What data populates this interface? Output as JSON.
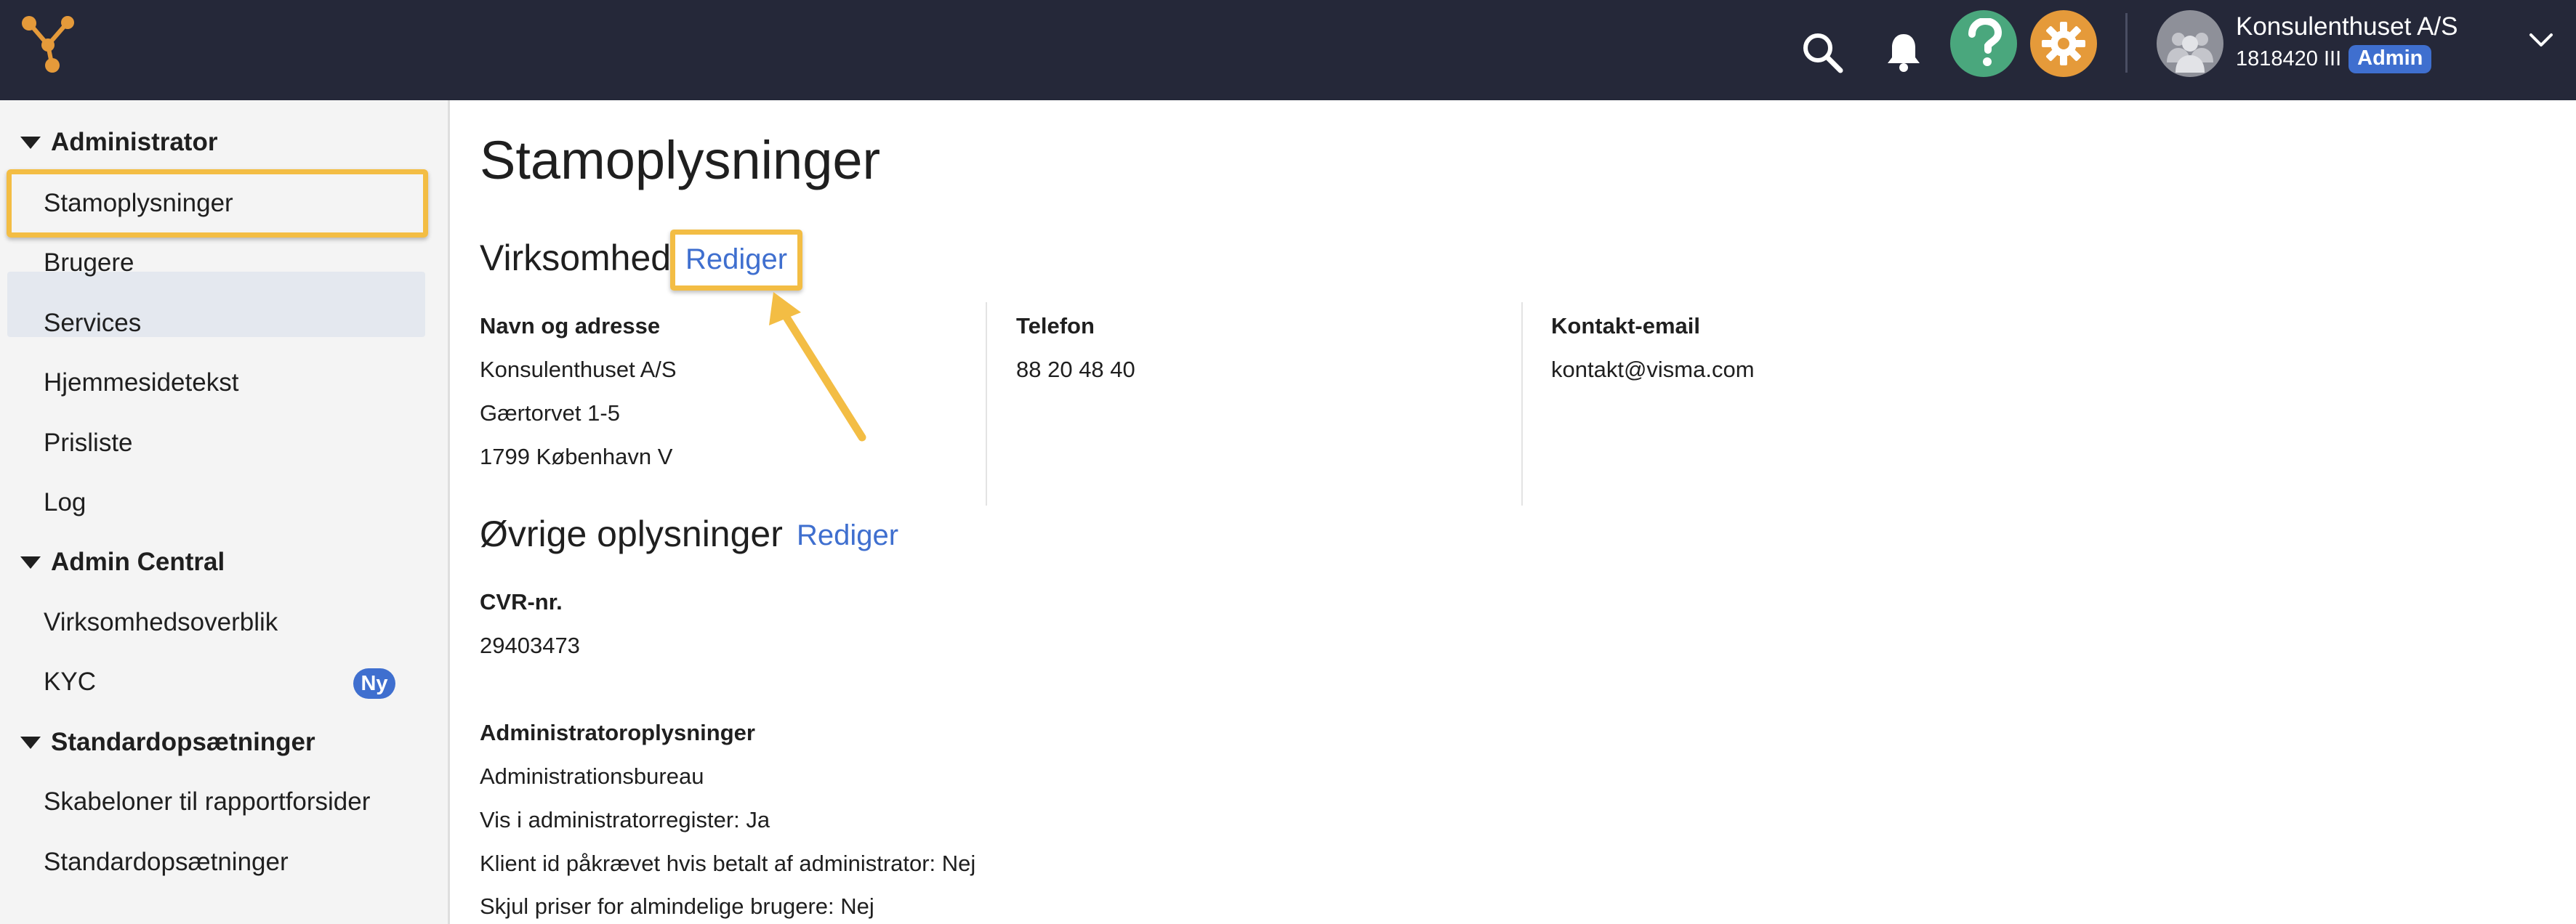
{
  "colors": {
    "topbar": "#252839",
    "accent_link": "#3f6fcf",
    "highlight": "#f3bd44",
    "help_button": "#4aa77d",
    "settings_button": "#e59a3a"
  },
  "header": {
    "company_name": "Konsulenthuset A/S",
    "company_id": "1818420 III",
    "role_badge": "Admin",
    "icons": [
      "logo-icon",
      "search-icon",
      "bell-icon",
      "help-icon",
      "gear-icon",
      "avatar-icon",
      "chevron-down-icon"
    ]
  },
  "sidebar": {
    "sections": [
      {
        "label": "Administrator",
        "items": [
          "Stamoplysninger",
          "Brugere",
          "Services",
          "Hjemmesidetekst",
          "Prisliste",
          "Log"
        ]
      },
      {
        "label": "Admin Central",
        "items": [
          "Virksomhedsoverblik",
          "KYC"
        ]
      },
      {
        "label": "Standardopsætninger",
        "items": [
          "Skabeloner til rapportforsider",
          "Standardopsætninger"
        ]
      }
    ],
    "active_item": "Stamoplysninger",
    "kyc_badge": "Ny"
  },
  "main": {
    "title": "Stamoplysninger",
    "company_section": {
      "title": "Virksomhed",
      "edit_label": "Rediger",
      "address_label": "Navn og adresse",
      "address_lines": [
        "Konsulenthuset A/S",
        "Gærtorvet 1-5",
        "1799 København V"
      ],
      "phone_label": "Telefon",
      "phone_value": "88 20 48 40",
      "email_label": "Kontakt-email",
      "email_value": "kontakt@visma.com"
    },
    "other_section": {
      "title": "Øvrige oplysninger",
      "edit_label": "Rediger",
      "cvr_label": "CVR-nr.",
      "cvr_value": "29403473",
      "admin_label": "Administratoroplysninger",
      "admin_lines": [
        "Administrationsbureau",
        "Vis i administratorregister: Ja",
        "Klient id påkrævet hvis betalt af administrator: Nej",
        "Skjul priser for almindelige brugere: Nej"
      ]
    }
  }
}
